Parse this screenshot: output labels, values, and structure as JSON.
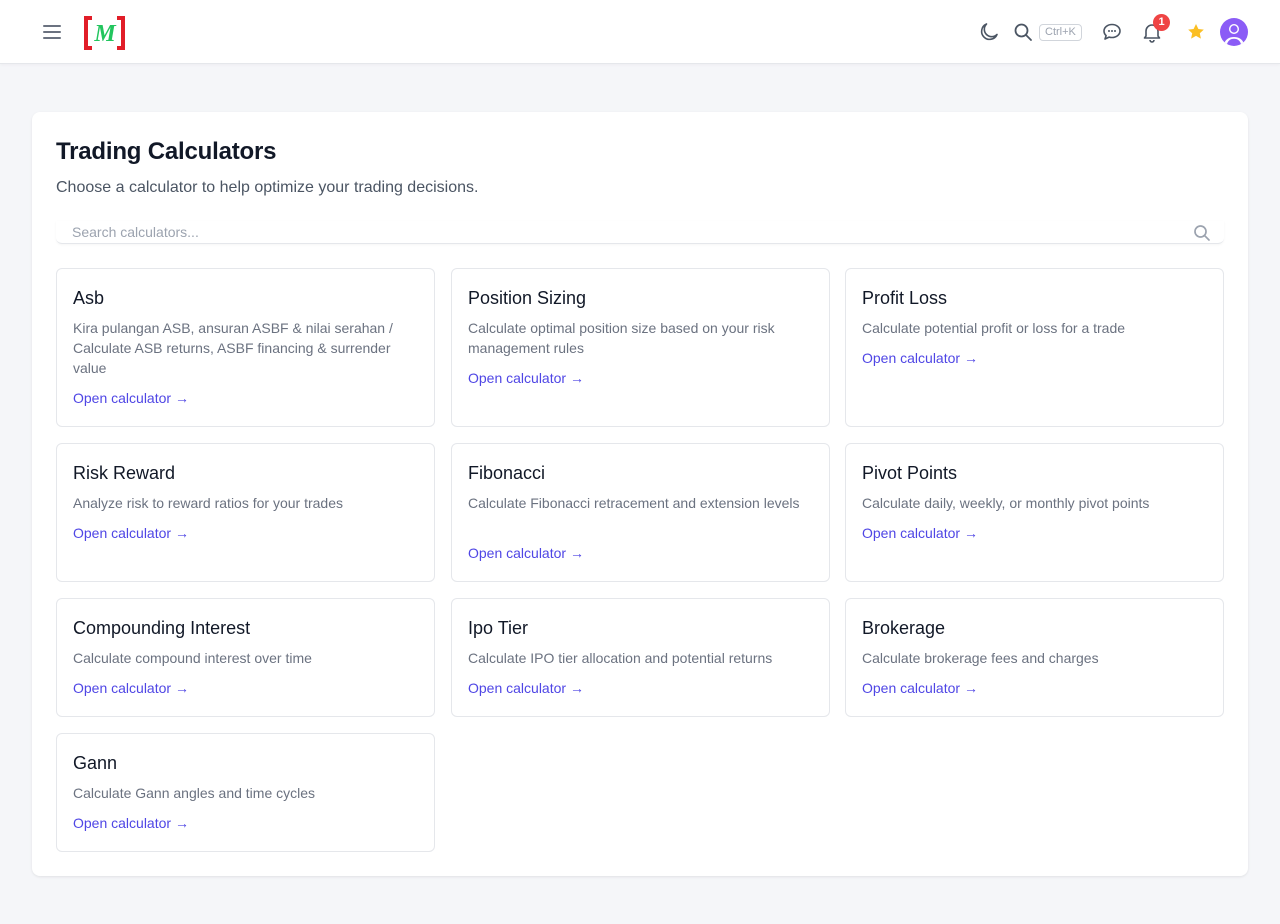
{
  "header": {
    "menu_icon": "hamburger-icon",
    "logo_text": "M",
    "icons": [
      "moon-icon",
      "search-icon",
      "chat-icon",
      "bell-icon",
      "star-icon",
      "user-avatar-icon"
    ],
    "search_shortcut": "Ctrl+K",
    "notification_count": "1",
    "colors": {
      "logo_bracket": "#e11d28",
      "logo_letter": "#22c55e",
      "star": "#fbbf24",
      "avatar": "#8b5cf6",
      "badge": "#ef4444"
    }
  },
  "page": {
    "title": "Trading Calculators",
    "subtitle": "Choose a calculator to help optimize your trading decisions.",
    "search_placeholder": "Search calculators..."
  },
  "calculators": [
    {
      "title": "Asb",
      "description": "Kira pulangan ASB, ansuran ASBF & nilai serahan / Calculate ASB returns, ASBF financing & surrender value",
      "link": "Open calculator →"
    },
    {
      "title": "Position Sizing",
      "description": "Calculate optimal position size based on your risk management rules",
      "link": "Open calculator →"
    },
    {
      "title": "Profit Loss",
      "description": "Calculate potential profit or loss for a trade",
      "link": "Open calculator →"
    },
    {
      "title": "Risk Reward",
      "description": "Analyze risk to reward ratios for your trades",
      "link": "Open calculator →"
    },
    {
      "title": "Fibonacci",
      "description": "Calculate Fibonacci retracement and extension levels",
      "link": "Open calculator →"
    },
    {
      "title": "Pivot Points",
      "description": "Calculate daily, weekly, or monthly pivot points",
      "link": "Open calculator →"
    },
    {
      "title": "Compounding Interest",
      "description": "Calculate compound interest over time",
      "link": "Open calculator →"
    },
    {
      "title": "Ipo Tier",
      "description": "Calculate IPO tier allocation and potential returns",
      "link": "Open calculator →"
    },
    {
      "title": "Brokerage",
      "description": "Calculate brokerage fees and charges",
      "link": "Open calculator →"
    },
    {
      "title": "Gann",
      "description": "Calculate Gann angles and time cycles",
      "link": "Open calculator →"
    }
  ],
  "accent_color": "#4f46e5"
}
